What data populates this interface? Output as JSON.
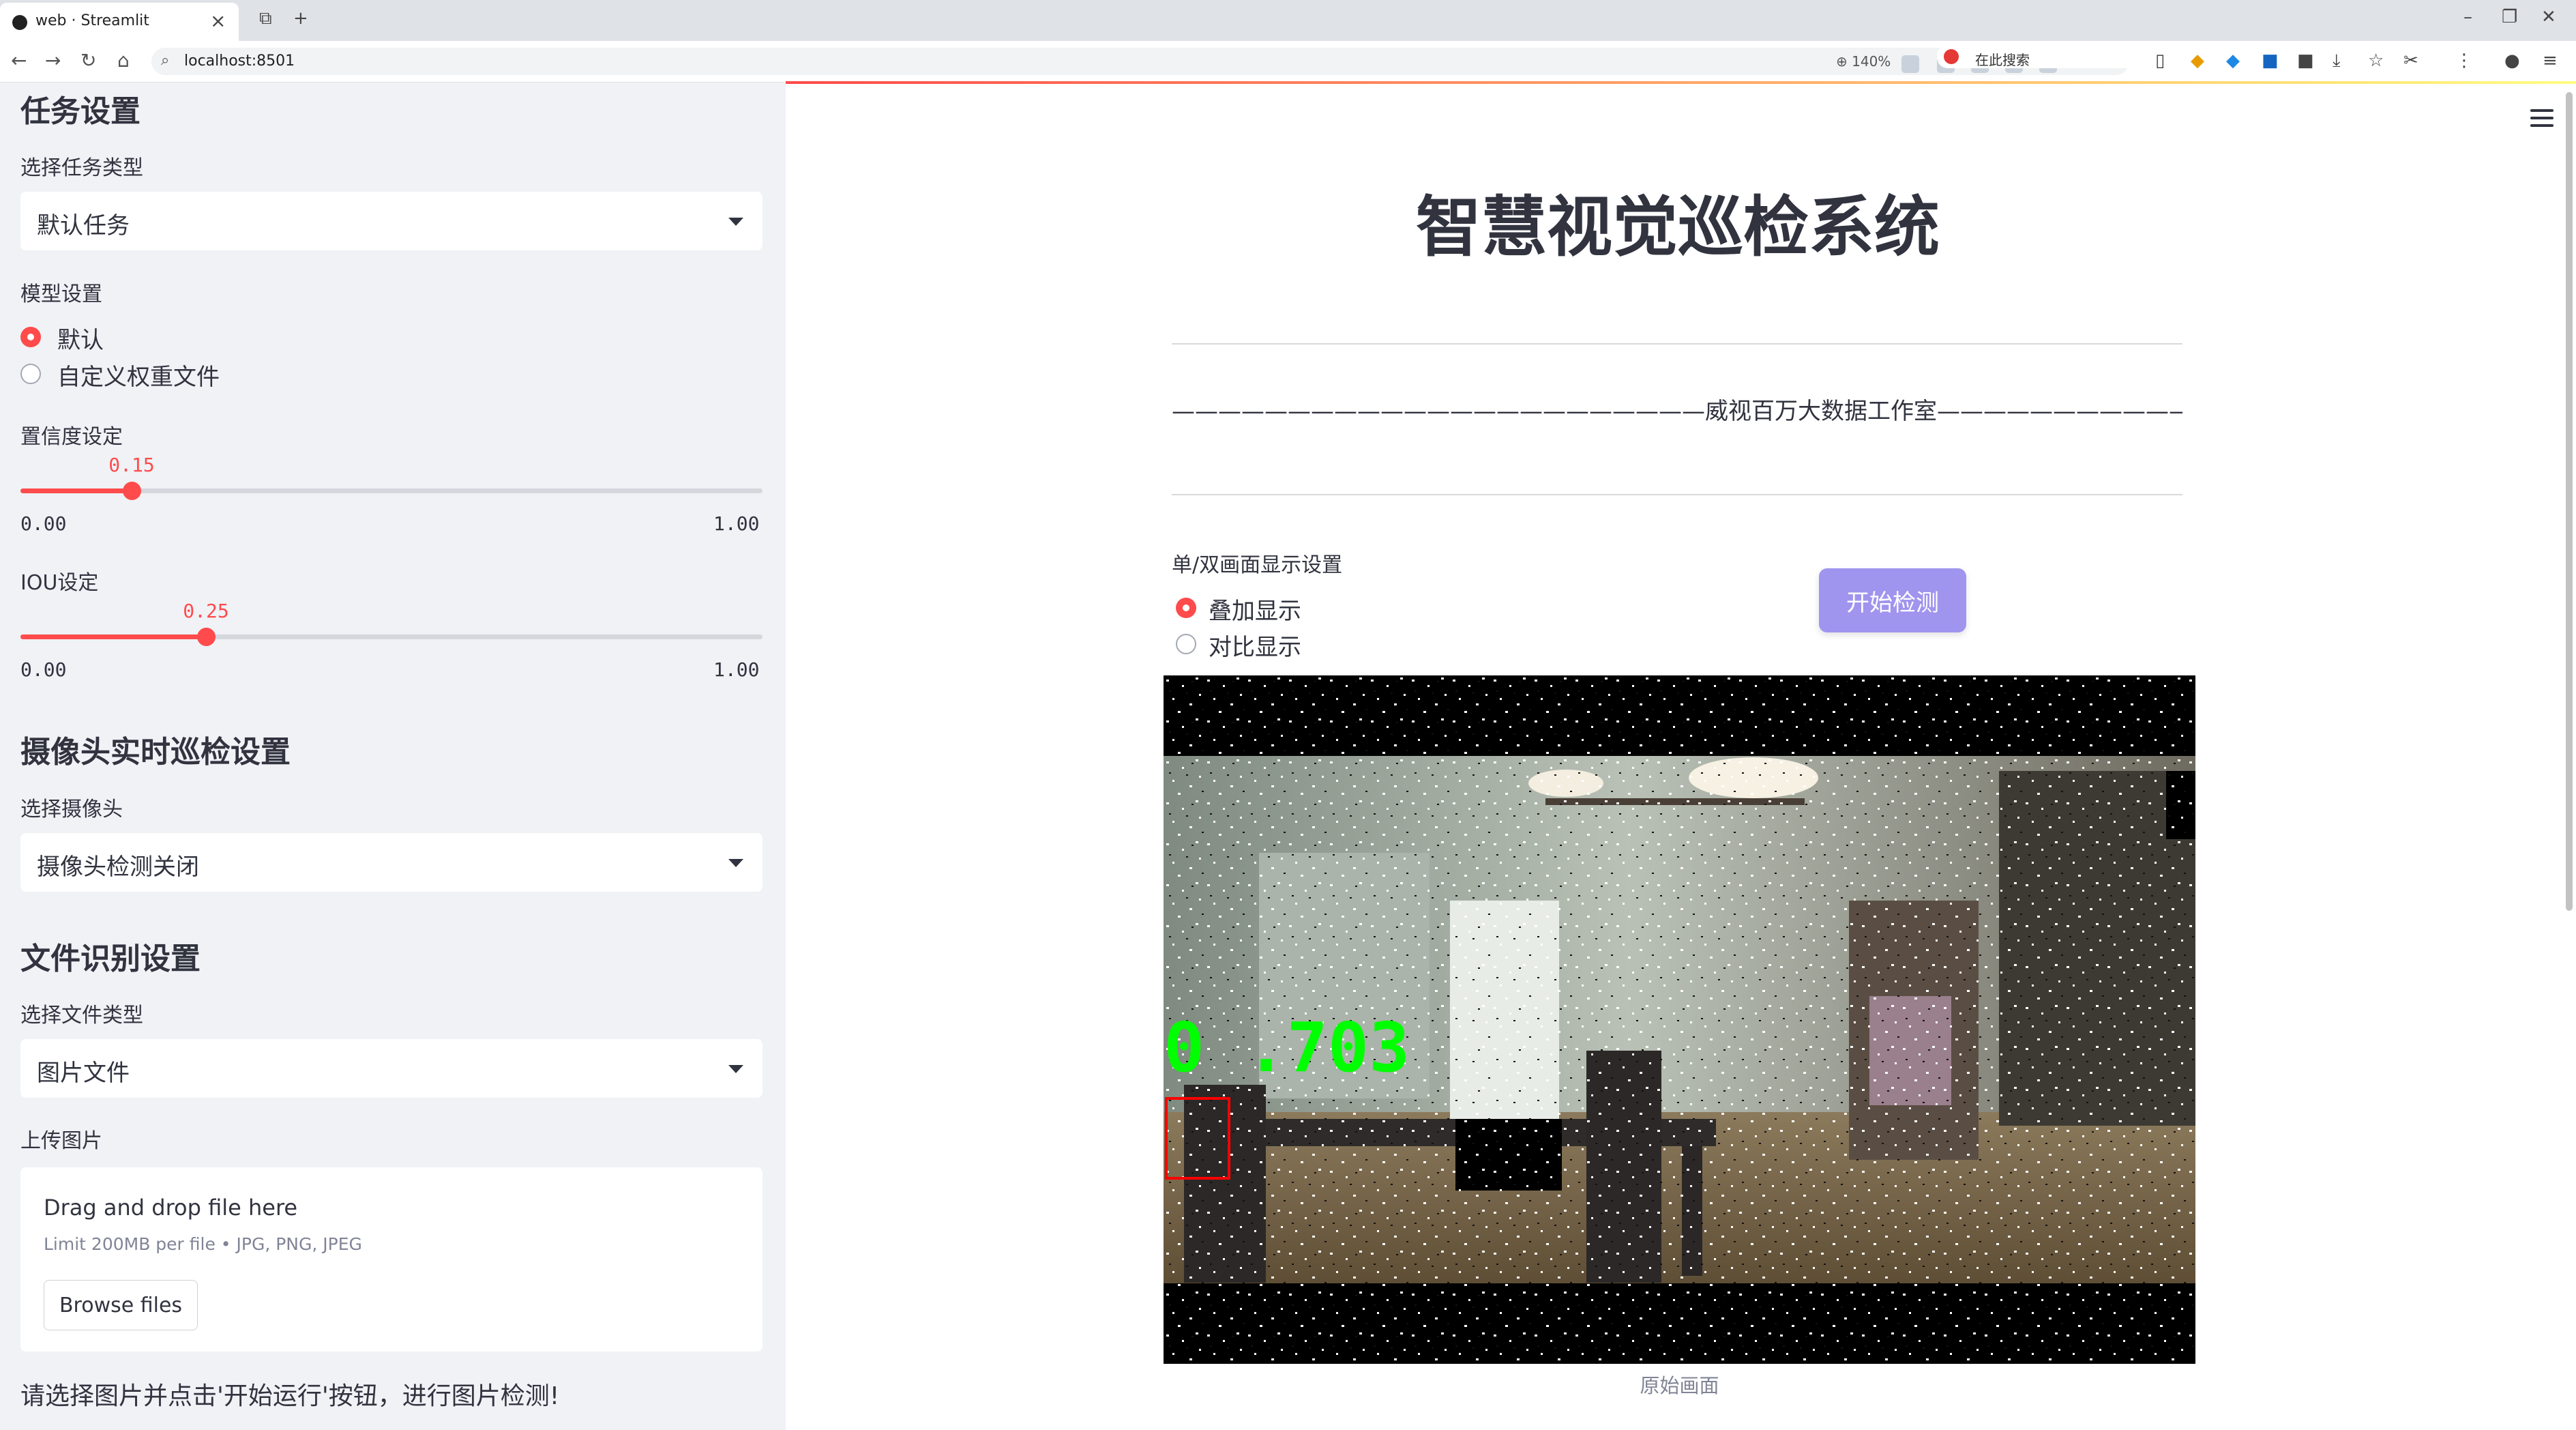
{
  "browser": {
    "tab_title": "web · Streamlit",
    "url": "localhost:8501",
    "zoom": "140%",
    "search_placeholder": "在此搜索"
  },
  "sidebar": {
    "task_section_title": "任务设置",
    "task_type_label": "选择任务类型",
    "task_type_value": "默认任务",
    "model_label": "模型设置",
    "model_options": [
      "默认",
      "自定义权重文件"
    ],
    "model_selected": "默认",
    "conf_label": "置信度设定",
    "conf_value": "0.15",
    "conf_min": "0.00",
    "conf_max": "1.00",
    "iou_label": "IOU设定",
    "iou_value": "0.25",
    "iou_min": "0.00",
    "iou_max": "1.00",
    "camera_section_title": "摄像头实时巡检设置",
    "camera_label": "选择摄像头",
    "camera_value": "摄像头检测关闭",
    "file_section_title": "文件识别设置",
    "file_type_label": "选择文件类型",
    "file_type_value": "图片文件",
    "upload_label": "上传图片",
    "upload_title": "Drag and drop file here",
    "upload_limit": "Limit 200MB per file • JPG, PNG, JPEG",
    "browse_label": "Browse files",
    "note": "请选择图片并点击'开始运行'按钮，进行图片检测!"
  },
  "main": {
    "title": "智慧视觉巡检系统",
    "divider_text": "———————————————————————威视百万大数据工作室————————————————————————",
    "display_label": "单/双画面显示设置",
    "display_options": [
      "叠加显示",
      "对比显示"
    ],
    "display_selected": "叠加显示",
    "start_button": "开始检测",
    "detection_label": "0 .703",
    "image_caption": "原始画面"
  },
  "colors": {
    "accent": "#ff4b4b",
    "button": "#9f95ee",
    "sidebar_bg": "#f0f2f6",
    "detection_text": "#00ff00",
    "detection_box": "#ff0000"
  }
}
